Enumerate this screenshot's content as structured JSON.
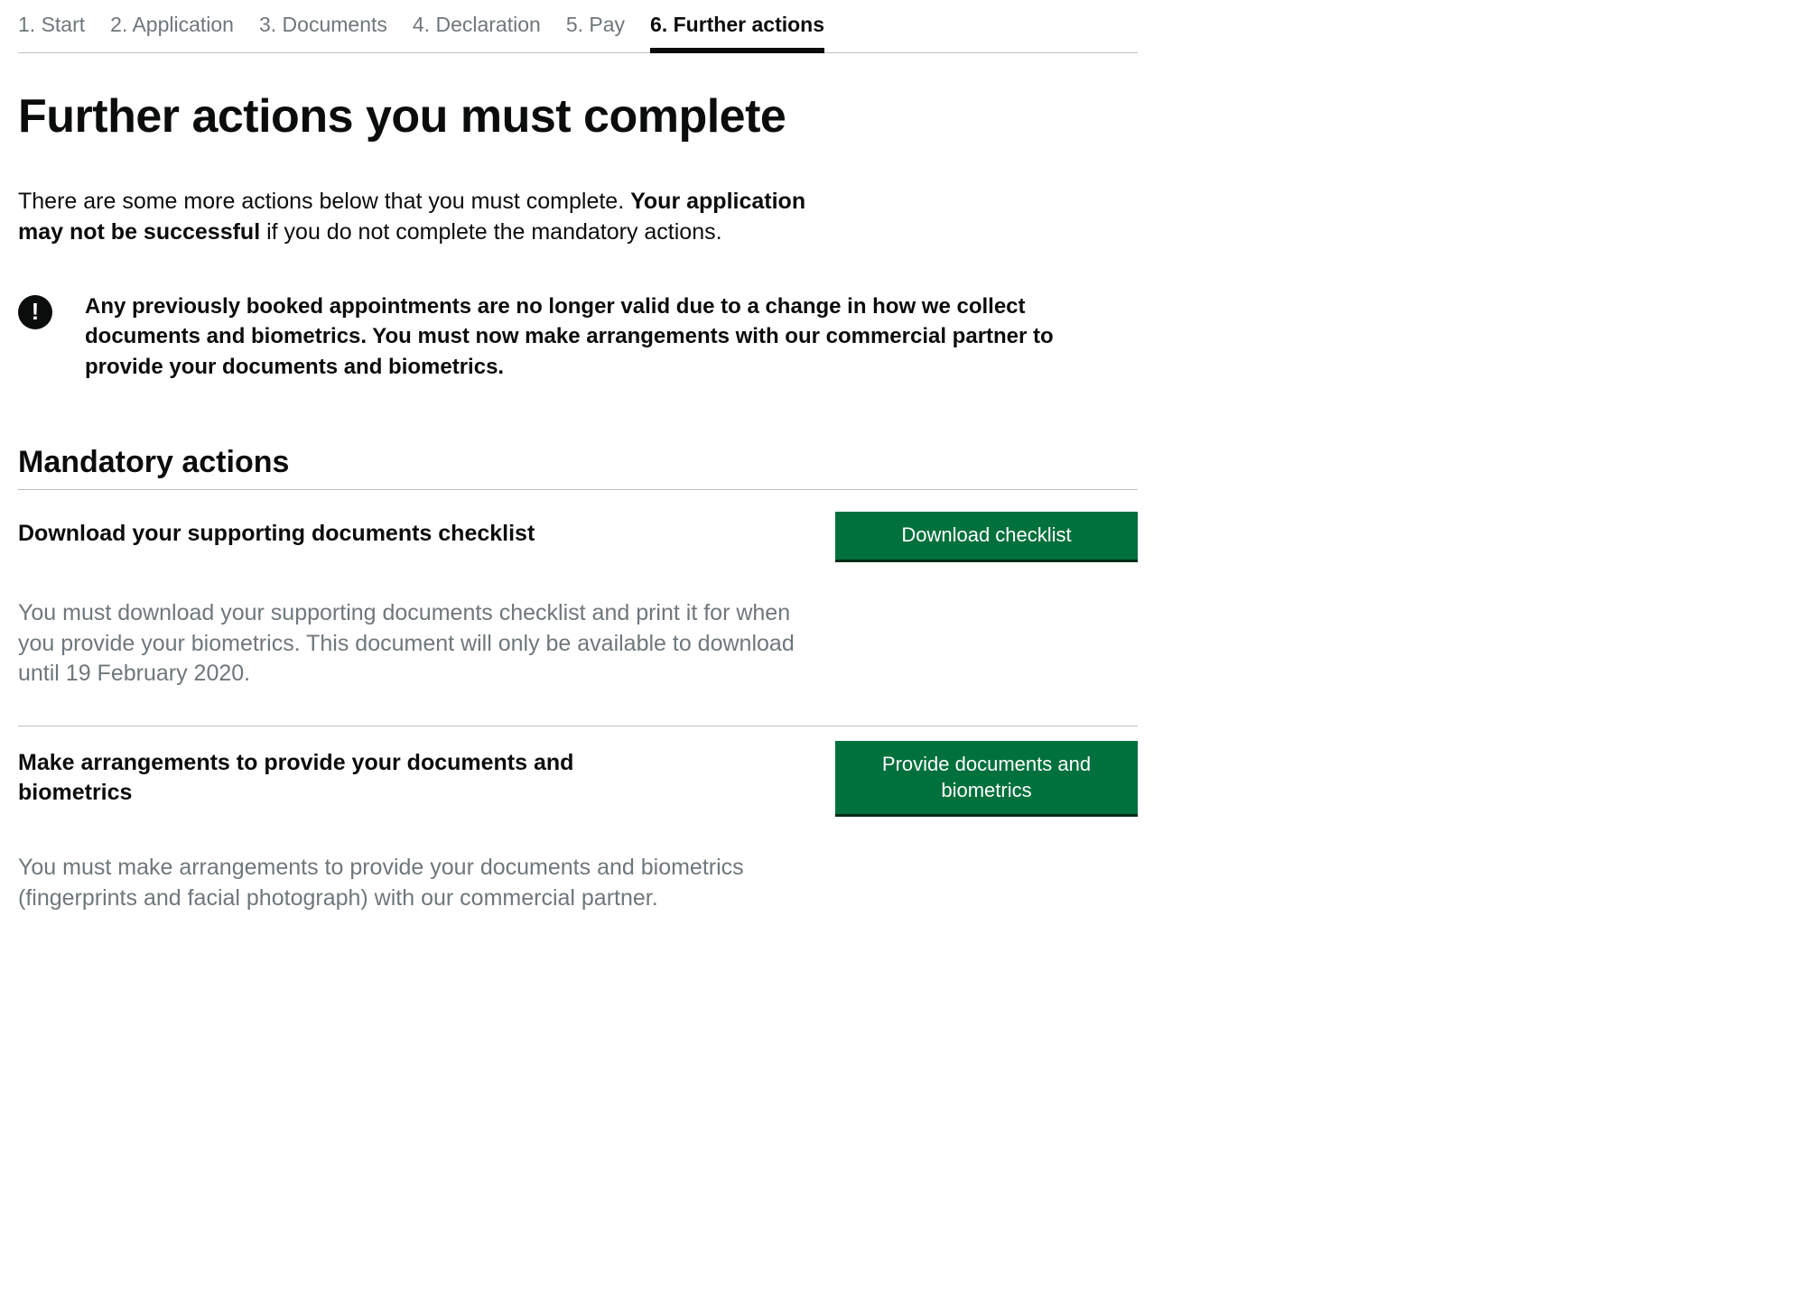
{
  "tabs": [
    {
      "label": "1. Start"
    },
    {
      "label": "2. Application"
    },
    {
      "label": "3. Documents"
    },
    {
      "label": "4. Declaration"
    },
    {
      "label": "5. Pay"
    },
    {
      "label": "6. Further actions",
      "active": true
    }
  ],
  "page": {
    "title": "Further actions you must complete",
    "intro_leading": "There are some more actions below that you must complete. ",
    "intro_bold": "Your application may not be successful",
    "intro_trailing": " if you do not complete the mandatory actions.",
    "warning": "Any previously booked appointments are no longer valid due to a change in how we collect documents and biometrics. You must now make arrangements with our commercial partner to provide your documents and biometrics."
  },
  "mandatory": {
    "heading": "Mandatory actions",
    "actions": [
      {
        "title": "Download your supporting documents checklist",
        "button": "Download checklist",
        "body": "You must download your supporting documents checklist and print it for when you provide your biometrics. This document will only be available to download until 19 February 2020."
      },
      {
        "title": "Make arrangements to provide your documents and biometrics",
        "button": "Provide documents and biometrics",
        "body": "You must make arrangements to provide your documents and biometrics (fingerprints and facial photograph) with our commercial partner."
      }
    ]
  }
}
